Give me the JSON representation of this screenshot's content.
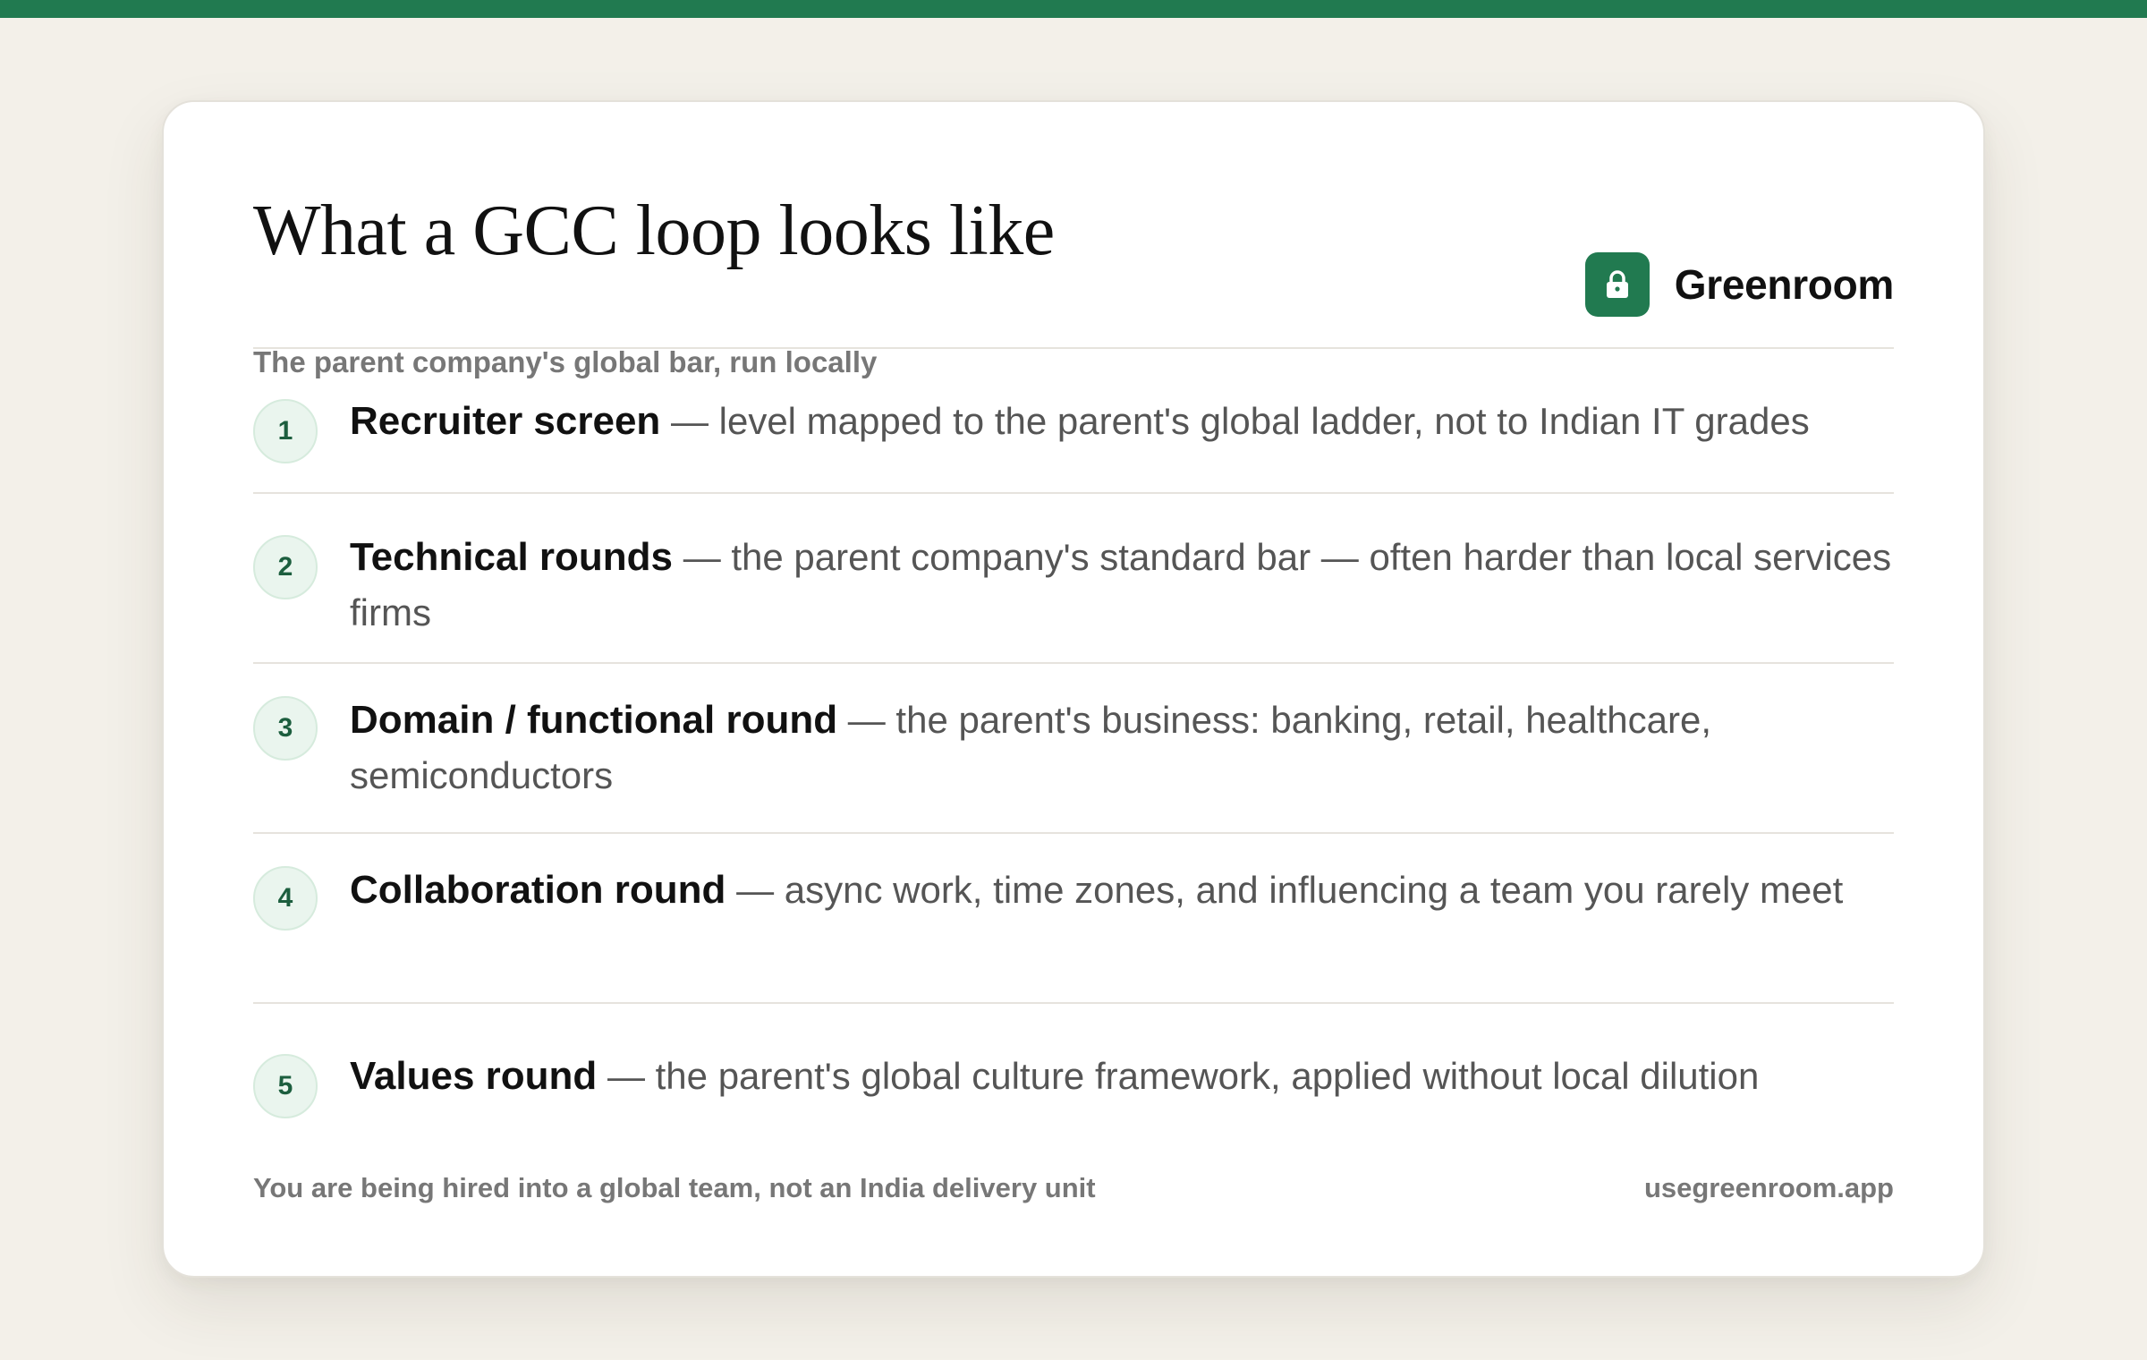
{
  "header": {
    "title": "What a GCC loop looks like",
    "subtitle": "The parent company's global bar, run locally"
  },
  "brand": {
    "name": "Greenroom",
    "logo_icon": "lock-icon",
    "color": "#217a50"
  },
  "steps": [
    {
      "number": "1",
      "name": "Recruiter screen",
      "description": " — level mapped to the parent's global ladder, not to Indian IT grades"
    },
    {
      "number": "2",
      "name": "Technical rounds",
      "description": " — the parent company's standard bar — often harder than local services firms"
    },
    {
      "number": "3",
      "name": "Domain / functional round",
      "description": " — the parent's business: banking, retail, healthcare, semiconductors"
    },
    {
      "number": "4",
      "name": "Collaboration round",
      "description": " — async work, time zones, and influencing a team you rarely meet"
    },
    {
      "number": "5",
      "name": "Values round",
      "description": " — the parent's global culture framework, applied without local dilution"
    }
  ],
  "footer": {
    "note": "You are being hired into a global team, not an India delivery unit",
    "url": "usegreenroom.app"
  },
  "colors": {
    "accent": "#217a50",
    "background": "#f3f0e9",
    "card": "#ffffff"
  }
}
